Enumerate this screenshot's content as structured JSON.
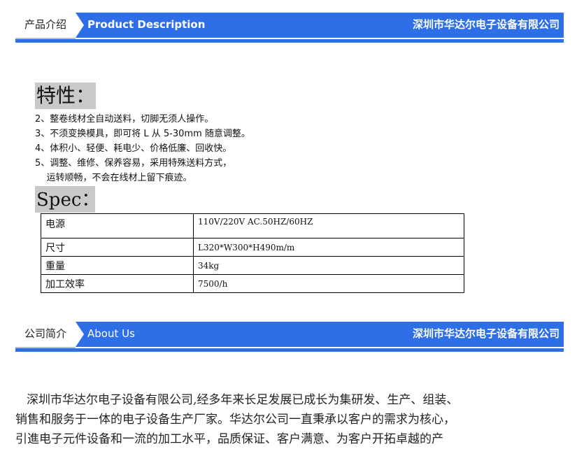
{
  "section1": {
    "tab_label": "产品介绍",
    "title_en": "Product Description",
    "company": "深圳市华达尔电子设备有限公司"
  },
  "features": {
    "title": "特性：",
    "items": [
      "2、整卷线材全自动送料，切脚无须人操作。",
      "3、不须变换模具，即可将 L 从 5-30mm 随意调整。",
      "4、体积小、轻便、耗电少、价格低廉、回收快。",
      "5、调整、维修、保养容易，采用特殊送料方式，",
      "    运转顺畅，不会在线材上留下痕迹。"
    ]
  },
  "spec": {
    "title": "Spec：",
    "rows": [
      {
        "key": "电源",
        "value": "110V/220V    AC.50HZ/60HZ"
      },
      {
        "key": "尺寸",
        "value": "L320*W300*H490m/m"
      },
      {
        "key": "重量",
        "value": "34kg"
      },
      {
        "key": "加工效率",
        "value": "7500/h"
      }
    ]
  },
  "section2": {
    "tab_label": "公司简介",
    "title_en": "About Us",
    "company": "深圳市华达尔电子设备有限公司"
  },
  "about": {
    "lines": [
      "深圳市华达尔电子设备有限公司,经多年来长足发展已成长为集研发、生产、组装、",
      "销售和服务于一体的电子设备生产厂家。华达尔公司一直秉承以客户的需求为核心，",
      "引進电子元件设备和一流的加工水平，品质保证、客户满意、为客户开拓卓越的产"
    ]
  },
  "colors": {
    "accent": "#2e6fe8",
    "tab_underline": "#bdbdbd",
    "heading_bg": "#c9c9c9"
  }
}
